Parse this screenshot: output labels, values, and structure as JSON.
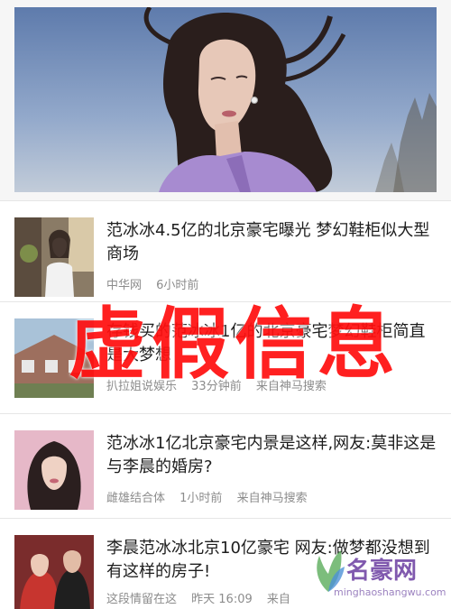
{
  "feed": {
    "items": [
      {
        "title": "范冰冰4.5亿的北京豪宅曝光 梦幻鞋柜似大型商场",
        "source": "中华网",
        "time": "6小时前",
        "via": ""
      },
      {
        "title": "存钱买的范冰冰1亿的北京豪宅梦幻鞋柜简直是大梦想",
        "source": "扒拉姐说娱乐",
        "time": "33分钟前",
        "via": "来自神马搜索"
      },
      {
        "title": "范冰冰1亿北京豪宅内景是这样,网友:莫非这是与李晨的婚房?",
        "source": "雌雄结合体",
        "time": "1小时前",
        "via": "来自神马搜索"
      },
      {
        "title": "李晨范冰冰北京10亿豪宅 网友:做梦都没想到有这样的房子!",
        "source": "这段情留在这",
        "time": "昨天 16:09",
        "via": "来自"
      }
    ]
  },
  "stamp": {
    "text": "虚假信息",
    "color": "#ff1010"
  },
  "watermark": {
    "title": "名豪网",
    "url": "minghaoshangwu.com"
  },
  "colors": {
    "title": "#1d1d1d",
    "meta": "#8c8c8c",
    "divider": "#e6e6e6"
  }
}
